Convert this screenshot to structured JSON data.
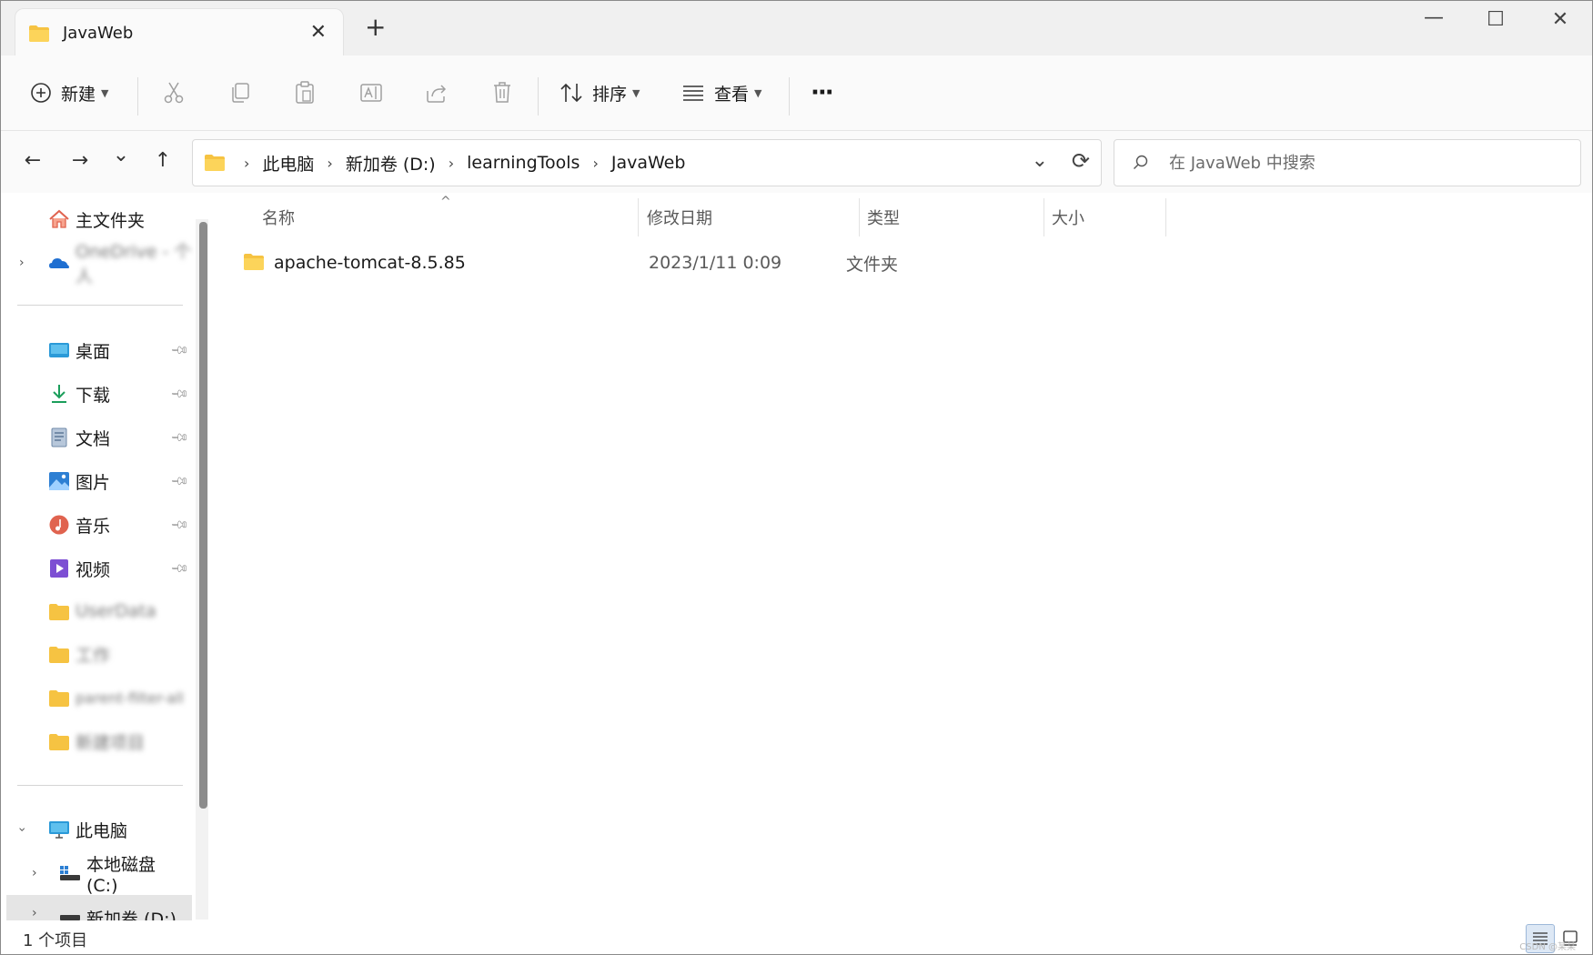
{
  "window": {
    "tab_title": "JavaWeb",
    "new_tab": "+",
    "close_tab": "✕",
    "minimize": "—",
    "maximize": "☐",
    "close": "✕"
  },
  "toolbar": {
    "new_label": "新建",
    "sort_label": "排序",
    "view_label": "查看",
    "more_label": "···",
    "icons": [
      "plus-circle-icon",
      "cut-icon",
      "copy-icon",
      "paste-icon",
      "rename-icon",
      "share-icon",
      "delete-icon",
      "sort-icon",
      "view-icon",
      "more-icon"
    ]
  },
  "nav": {
    "back": "←",
    "forward": "→",
    "recent": "⌄",
    "up": "↑",
    "breadcrumb": [
      "此电脑",
      "新加卷 (D:)",
      "learningTools",
      "JavaWeb"
    ],
    "crumb_sep": "›",
    "dropdown": "⌄",
    "refresh": "⟳"
  },
  "search": {
    "placeholder": "在 JavaWeb 中搜索"
  },
  "sidebar": {
    "home": "主文件夹",
    "cloud": "OneDrive - 个人",
    "quick_access": [
      {
        "label": "桌面",
        "icon": "desktop-icon",
        "color": "#2b9ad8"
      },
      {
        "label": "下载",
        "icon": "download-icon",
        "color": "#1b9e5b"
      },
      {
        "label": "文档",
        "icon": "document-icon",
        "color": "#6f89a8"
      },
      {
        "label": "图片",
        "icon": "pictures-icon",
        "color": "#2d7fd3"
      },
      {
        "label": "音乐",
        "icon": "music-icon",
        "color": "#e0634f"
      },
      {
        "label": "视频",
        "icon": "videos-icon",
        "color": "#7d4fd3"
      }
    ],
    "blurred_folders": [
      "UserData",
      "工作",
      "parent-filter-all",
      "新建项目"
    ],
    "this_pc": "此电脑",
    "drive_c": "本地磁盘 (C:)",
    "drive_d": "新加卷 (D:)"
  },
  "columns": {
    "name": "名称",
    "modified": "修改日期",
    "type": "类型",
    "size": "大小"
  },
  "files": [
    {
      "name": "apache-tomcat-8.5.85",
      "modified": "2023/1/11 0:09",
      "type": "文件夹",
      "size": ""
    }
  ],
  "status": {
    "count": "1 个项目",
    "watermark": "CSDN @某某"
  },
  "colors": {
    "folder": "#f6c342",
    "accent": "#2d7fd3"
  }
}
